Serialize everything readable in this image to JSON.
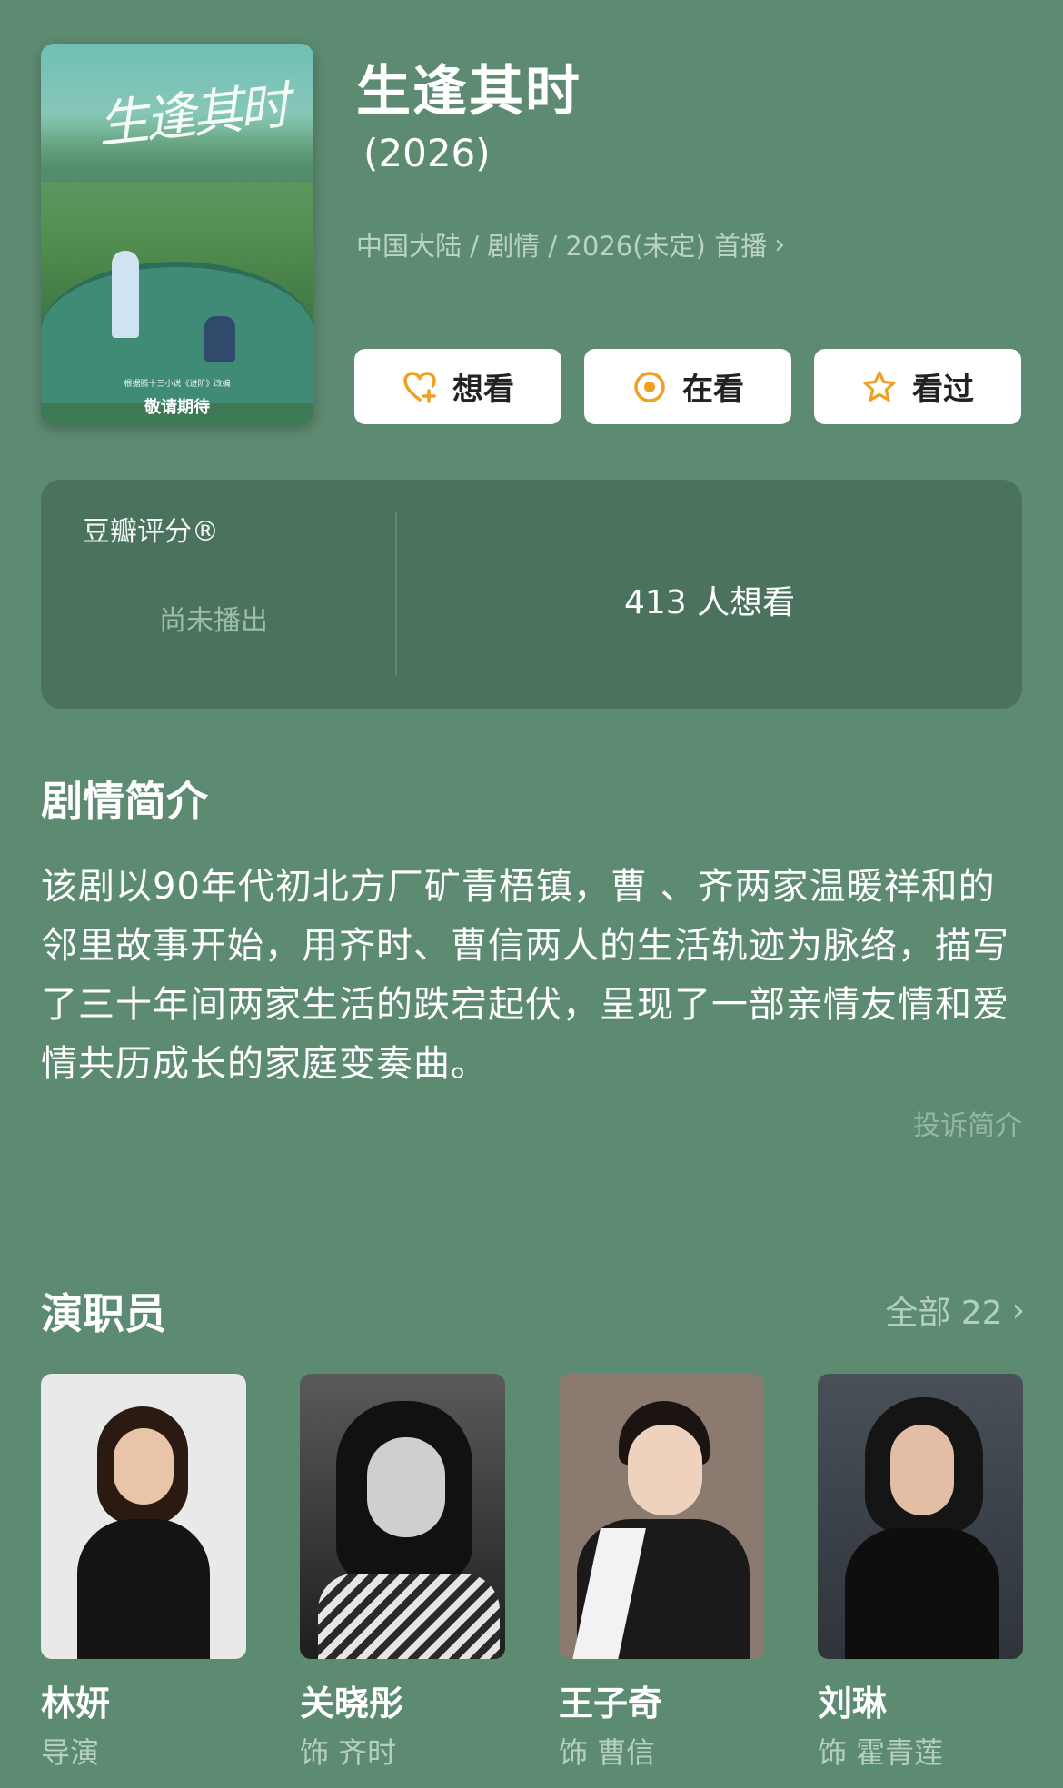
{
  "poster": {
    "calligraphy": "生逢其时",
    "small_text": "根据腾十三小说《进阶》改编",
    "caption": "敬请期待"
  },
  "header": {
    "title": "生逢其时",
    "year": "(2026)",
    "meta": "中国大陆 / 剧情 / 2026(未定) 首播"
  },
  "actions": [
    {
      "label": "想看",
      "icon": "heart-plus-icon"
    },
    {
      "label": "在看",
      "icon": "target-icon"
    },
    {
      "label": "看过",
      "icon": "star-icon"
    }
  ],
  "rating": {
    "label": "豆瓣评分®",
    "status": "尚未播出",
    "want_count": "413 人想看"
  },
  "synopsis": {
    "title": "剧情简介",
    "text": "该剧以90年代初北方厂矿青梧镇，曹 、齐两家温暖祥和的邻里故事开始，用齐时、曹信两人的生活轨迹为脉络，描写了三十年间两家生活的跌宕起伏，呈现了一部亲情友情和爱情共历成长的家庭变奏曲。",
    "report": "投诉简介"
  },
  "cast": {
    "title": "演职员",
    "all_label": "全部 22",
    "members": [
      {
        "name": "林妍",
        "role": "导演"
      },
      {
        "name": "关晓彤",
        "role": "饰 齐时"
      },
      {
        "name": "王子奇",
        "role": "饰 曹信"
      },
      {
        "name": "刘琳",
        "role": "饰 霍青莲"
      }
    ]
  },
  "colors": {
    "background": "#5d8b71",
    "card": "#4a725d",
    "accent": "#f0a020"
  }
}
